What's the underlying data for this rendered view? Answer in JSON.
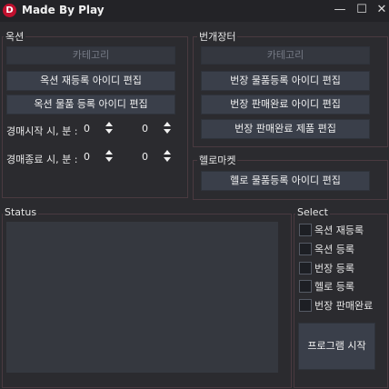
{
  "window": {
    "title": "Made By Play",
    "icon_letter": "D",
    "minimize": "—",
    "maximize": "☐",
    "close": "✕"
  },
  "auction": {
    "title": "옥션",
    "category_button": "카테고리",
    "relist_button": "옥션 재등록 아이디 편집",
    "register_button": "옥션 물품 등록 아이디 편집",
    "start_label": "경매시작 시, 분 :",
    "start_hour": "0",
    "start_minute": "0",
    "end_label": "경매종료 시, 분 :",
    "end_hour": "0",
    "end_minute": "0"
  },
  "bungae": {
    "title": "번개장터",
    "category_button": "카테고리",
    "register_button": "번장 물품등록 아이디 편집",
    "sold_button": "번장 판매완료 아이디 편집",
    "sold_products_button": "번장 판매완료 제품 편집"
  },
  "hello": {
    "title": "헬로마켓",
    "register_button": "헬로 물품등록 아이디 편집"
  },
  "status": {
    "title": "Status"
  },
  "select": {
    "title": "Select",
    "options": [
      {
        "label": "옥션 재등록",
        "checked": false
      },
      {
        "label": "옥션 등록",
        "checked": false
      },
      {
        "label": "번장 등록",
        "checked": false
      },
      {
        "label": "헬로 등록",
        "checked": false
      },
      {
        "label": "번장 판매완료",
        "checked": false
      }
    ],
    "start_button": "프로그램 시작"
  }
}
